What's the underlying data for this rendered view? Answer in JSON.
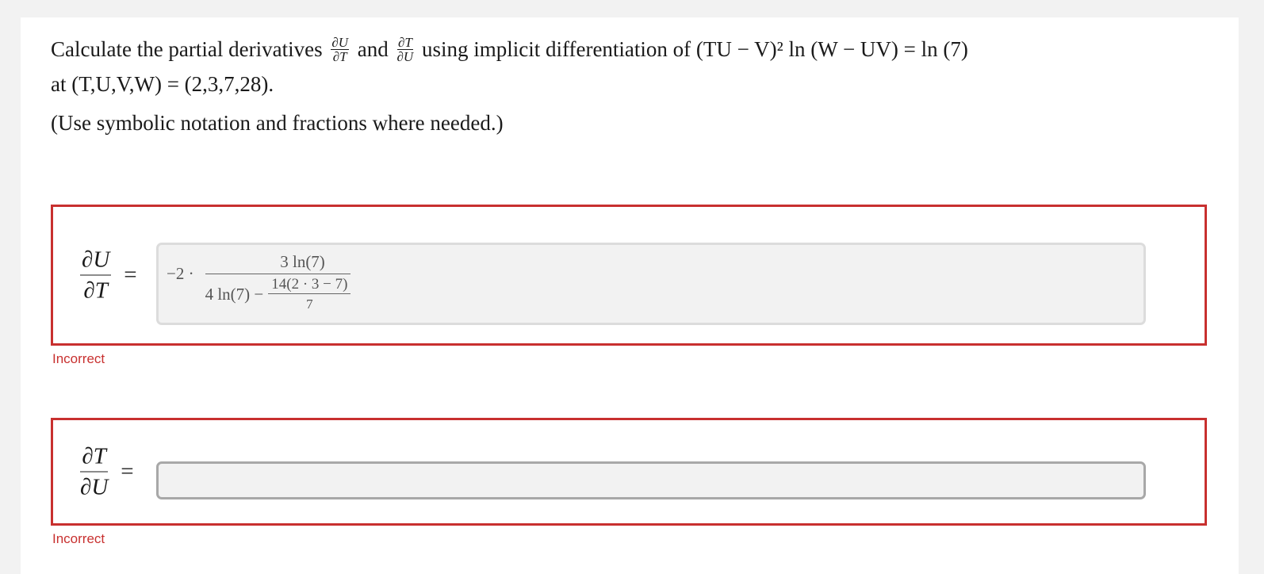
{
  "question": {
    "prefix": "Calculate the partial derivatives",
    "frac1_num": "∂U",
    "frac1_den": "∂T",
    "and_word": "and",
    "frac2_num": "∂T",
    "frac2_den": "∂U",
    "suffix": "using implicit differentiation of (TU − V)² ln (W − UV) = ln (7)",
    "line2": "at (T,U,V,W) = (2,3,7,28).",
    "hint": "(Use symbolic notation and fractions where needed.)"
  },
  "answers": [
    {
      "lhs_num": "∂U",
      "lhs_den": "∂T",
      "equals": "=",
      "entered": {
        "coef": "−2 ·",
        "numerator": "3 ln(7)",
        "den_left": "4 ln(7) −",
        "inner_num": "14(2 · 3 − 7)",
        "inner_den": "7"
      },
      "feedback": "Incorrect"
    },
    {
      "lhs_num": "∂T",
      "lhs_den": "∂U",
      "equals": "=",
      "entered_value": "",
      "feedback": "Incorrect"
    }
  ],
  "colors": {
    "error": "#c8302f",
    "field_bg": "#f2f2f2",
    "page_bg": "#f2f2f2"
  }
}
